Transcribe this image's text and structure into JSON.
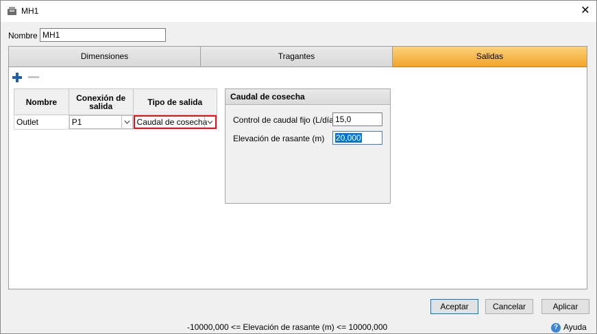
{
  "window": {
    "title": "MH1",
    "close_glyph": "✕"
  },
  "name_field": {
    "label": "Nombre",
    "value": "MH1"
  },
  "tabs": [
    {
      "label": "Dimensiones",
      "active": false
    },
    {
      "label": "Tragantes",
      "active": false
    },
    {
      "label": "Salidas",
      "active": true
    }
  ],
  "toolbar": {
    "add_icon": "plus-icon",
    "remove_icon": "minus-icon"
  },
  "grid": {
    "headers": [
      "Nombre",
      "Conexión de salida",
      "Tipo de salida"
    ],
    "rows": [
      {
        "nombre": "Outlet",
        "conexion": "P1",
        "tipo": "Caudal de cosecha"
      }
    ]
  },
  "panel": {
    "title": "Caudal de cosecha",
    "fields": [
      {
        "label": "Control de caudal fijo (L/día)",
        "value": "15,0"
      },
      {
        "label": "Elevación de rasante (m)",
        "value": "20,000"
      }
    ]
  },
  "buttons": {
    "accept": "Aceptar",
    "cancel": "Cancelar",
    "apply": "Aplicar"
  },
  "status": "-10000,000 <= Elevación de rasante (m) <= 10000,000",
  "help": {
    "label": "Ayuda",
    "glyph": "?"
  },
  "colors": {
    "active_tab": "#f2a42a",
    "selected_cell_border": "#e1121b",
    "selection": "#0078d7"
  }
}
